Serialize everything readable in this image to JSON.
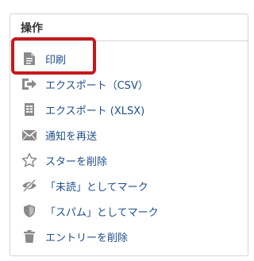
{
  "panel": {
    "title": "操作"
  },
  "actions": [
    {
      "label": "印刷",
      "icon": "document-icon"
    },
    {
      "label": "エクスポート（CSV）",
      "icon": "export-icon"
    },
    {
      "label": "エクスポート (XLSX)",
      "icon": "spreadsheet-icon"
    },
    {
      "label": "通知を再送",
      "icon": "envelope-icon"
    },
    {
      "label": "スターを削除",
      "icon": "star-outline-icon"
    },
    {
      "label": "「未読」としてマーク",
      "icon": "eye-slash-icon"
    },
    {
      "label": "「スパム」としてマーク",
      "icon": "shield-icon"
    },
    {
      "label": "エントリーを削除",
      "icon": "trash-icon"
    }
  ],
  "colors": {
    "link": "#1e4f8a",
    "icon": "#8a8a8a",
    "highlight": "#c41a1a",
    "border": "#d5d5d5"
  }
}
